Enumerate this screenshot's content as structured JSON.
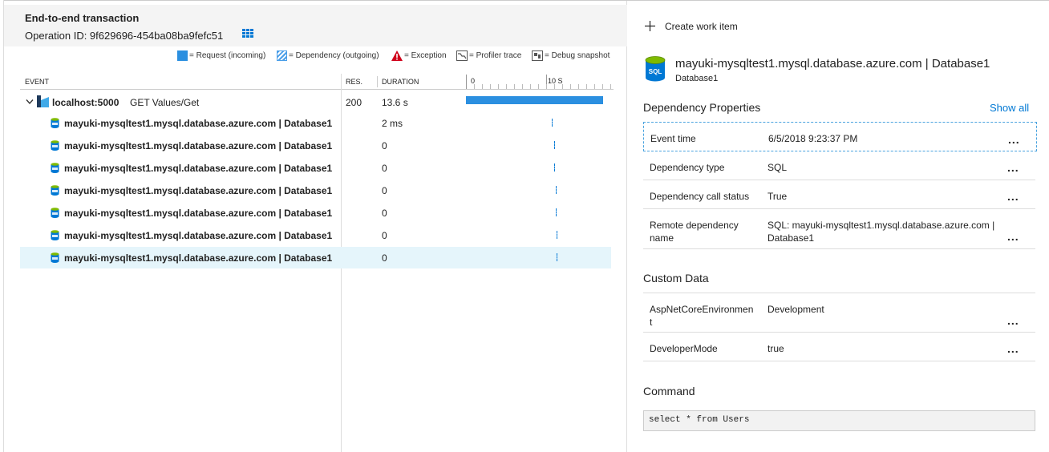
{
  "header": {
    "title": "End-to-end transaction",
    "operation_id": "Operation ID: 9f629696-454ba08ba9fefc51"
  },
  "legend": {
    "request": "= Request (incoming)",
    "dependency": "= Dependency (outgoing)",
    "exception": "= Exception",
    "profiler": "= Profiler trace",
    "debug": "= Debug snapshot"
  },
  "columns": {
    "event": "EVENT",
    "res": "RES.",
    "duration": "DURATION",
    "tick0": "0",
    "tick10": "10 S"
  },
  "root": {
    "host": "localhost:5000",
    "op": "GET Values/Get",
    "res": "200",
    "duration": "13.6 s"
  },
  "rows": [
    {
      "name": "mayuki-mysqltest1.mysql.database.azure.com | Database1",
      "duration": "2 ms"
    },
    {
      "name": "mayuki-mysqltest1.mysql.database.azure.com | Database1",
      "duration": "0"
    },
    {
      "name": "mayuki-mysqltest1.mysql.database.azure.com | Database1",
      "duration": "0"
    },
    {
      "name": "mayuki-mysqltest1.mysql.database.azure.com | Database1",
      "duration": "0"
    },
    {
      "name": "mayuki-mysqltest1.mysql.database.azure.com | Database1",
      "duration": "0"
    },
    {
      "name": "mayuki-mysqltest1.mysql.database.azure.com | Database1",
      "duration": "0"
    },
    {
      "name": "mayuki-mysqltest1.mysql.database.azure.com | Database1",
      "duration": "0"
    }
  ],
  "detail": {
    "create_work_item": "Create work item",
    "title": "mayuki-mysqltest1.mysql.database.azure.com | Database1",
    "subtitle": "Database1",
    "sql_icon_text": "SQL",
    "dep_props_heading": "Dependency Properties",
    "show_all": "Show all",
    "props": [
      {
        "key": "Event time",
        "value": "6/5/2018 9:23:37 PM"
      },
      {
        "key": "Dependency type",
        "value": "SQL"
      },
      {
        "key": "Dependency call status",
        "value": "True"
      },
      {
        "key": "Remote dependency name",
        "value": "SQL: mayuki-mysqltest1.mysql.database.azure.com | Database1"
      }
    ],
    "custom_heading": "Custom Data",
    "custom": [
      {
        "key": "AspNetCoreEnvironment",
        "value": "Development"
      },
      {
        "key": "DeveloperMode",
        "value": "true"
      }
    ],
    "command_heading": "Command",
    "command": "select * from Users",
    "more_label": "..."
  },
  "colors": {
    "accent": "#0078d4",
    "selected_row": "#e5f5fb",
    "exception": "#d0021b"
  }
}
